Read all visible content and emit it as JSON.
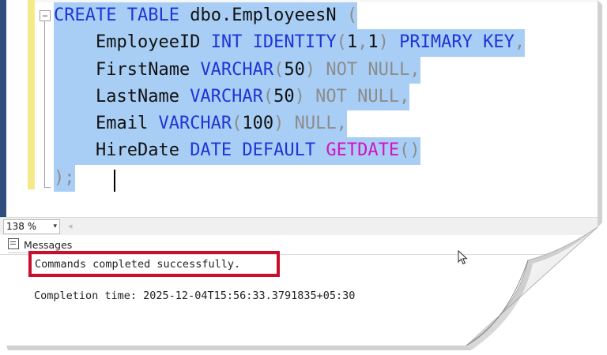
{
  "editor": {
    "lines": [
      {
        "segments": [
          [
            "kw",
            "CREATE"
          ],
          [
            "tx",
            " "
          ],
          [
            "kw",
            "TABLE"
          ],
          [
            "tx",
            " dbo.EmployeesN "
          ],
          [
            "gr",
            "("
          ]
        ]
      },
      {
        "segments": [
          [
            "tx",
            "    EmployeeID "
          ],
          [
            "kw",
            "INT"
          ],
          [
            "tx",
            " "
          ],
          [
            "kw",
            "IDENTITY"
          ],
          [
            "gr",
            "("
          ],
          [
            "tx",
            "1"
          ],
          [
            "gr",
            ","
          ],
          [
            "tx",
            "1"
          ],
          [
            "gr",
            ")"
          ],
          [
            "tx",
            " "
          ],
          [
            "kw",
            "PRIMARY"
          ],
          [
            "tx",
            " "
          ],
          [
            "kw",
            "KEY"
          ],
          [
            "gr",
            ","
          ]
        ]
      },
      {
        "segments": [
          [
            "tx",
            "    FirstName "
          ],
          [
            "kw",
            "VARCHAR"
          ],
          [
            "gr",
            "("
          ],
          [
            "tx",
            "50"
          ],
          [
            "gr",
            ")"
          ],
          [
            "tx",
            " "
          ],
          [
            "gr",
            "NOT"
          ],
          [
            "tx",
            " "
          ],
          [
            "gr",
            "NULL"
          ],
          [
            "gr",
            ","
          ]
        ]
      },
      {
        "segments": [
          [
            "tx",
            "    LastName "
          ],
          [
            "kw",
            "VARCHAR"
          ],
          [
            "gr",
            "("
          ],
          [
            "tx",
            "50"
          ],
          [
            "gr",
            ")"
          ],
          [
            "tx",
            " "
          ],
          [
            "gr",
            "NOT"
          ],
          [
            "tx",
            " "
          ],
          [
            "gr",
            "NULL"
          ],
          [
            "gr",
            ","
          ]
        ]
      },
      {
        "segments": [
          [
            "tx",
            "    Email "
          ],
          [
            "kw",
            "VARCHAR"
          ],
          [
            "gr",
            "("
          ],
          [
            "tx",
            "100"
          ],
          [
            "gr",
            ")"
          ],
          [
            "tx",
            " "
          ],
          [
            "gr",
            "NULL"
          ],
          [
            "gr",
            ","
          ]
        ]
      },
      {
        "segments": [
          [
            "tx",
            "    HireDate "
          ],
          [
            "kw",
            "DATE"
          ],
          [
            "tx",
            " "
          ],
          [
            "kw",
            "DEFAULT"
          ],
          [
            "tx",
            " "
          ],
          [
            "pk",
            "GETDATE"
          ],
          [
            "gr",
            "()"
          ]
        ]
      },
      {
        "segments": [
          [
            "gr",
            ");"
          ]
        ]
      }
    ],
    "fold_symbol": "−"
  },
  "zoom": {
    "value": "138 %",
    "arrow": "▾",
    "scroll_arrow": "◂"
  },
  "results": {
    "tab_label": "Messages",
    "success_message": "Commands completed successfully.",
    "completion_time": "Completion time: 2025-12-04T15:56:33.3791835+05:30"
  },
  "colors": {
    "keyword": "#1e35d6",
    "punctuation": "#8c8c8c",
    "function": "#d412c4",
    "selection": "#a9cef5",
    "highlight_box": "#c8102e"
  }
}
